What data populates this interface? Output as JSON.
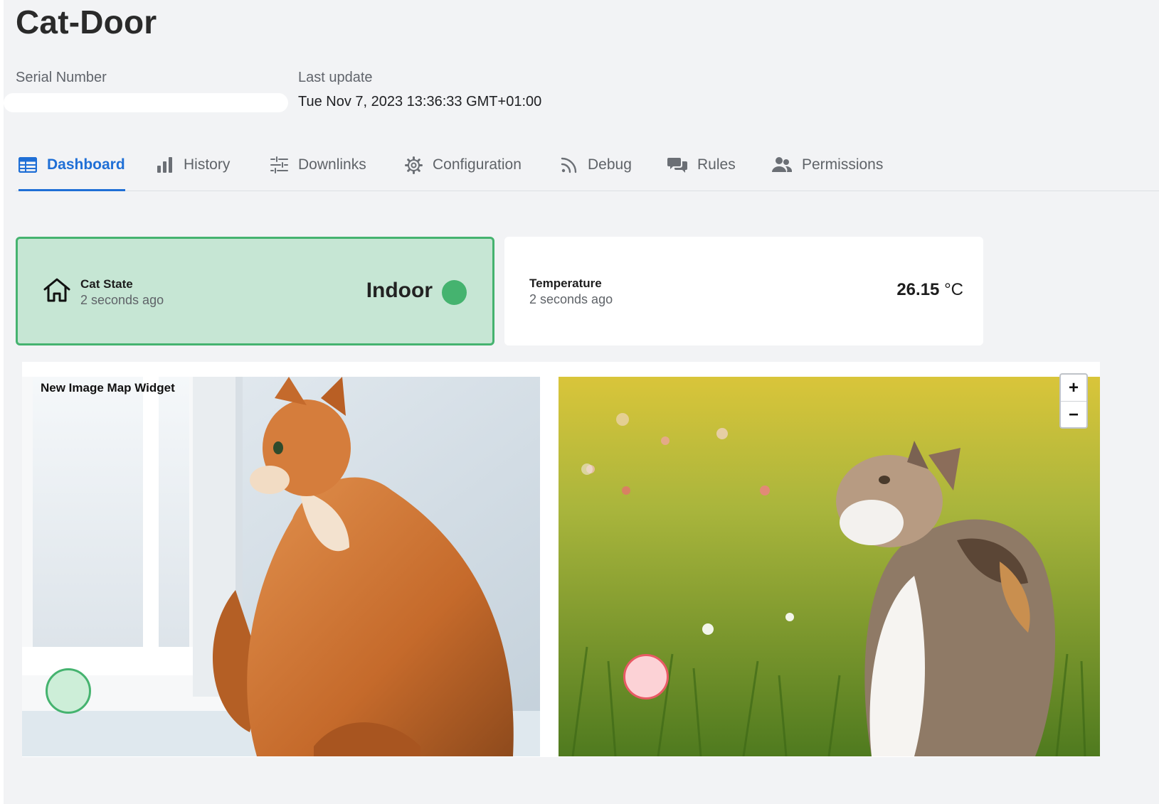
{
  "page": {
    "title": "Cat-Door"
  },
  "meta": {
    "serial_label": "Serial Number",
    "last_update_label": "Last update",
    "last_update_value": "Tue Nov 7, 2023 13:36:33 GMT+01:00"
  },
  "tabs": [
    {
      "label": "Dashboard",
      "icon": "table-icon",
      "active": true
    },
    {
      "label": "History",
      "icon": "bar-chart-icon"
    },
    {
      "label": "Downlinks",
      "icon": "sliders-icon"
    },
    {
      "label": "Configuration",
      "icon": "gear-icon"
    },
    {
      "label": "Debug",
      "icon": "rss-icon"
    },
    {
      "label": "Rules",
      "icon": "chat-bubbles-icon"
    },
    {
      "label": "Permissions",
      "icon": "users-icon"
    }
  ],
  "cards": {
    "cat_state": {
      "name": "Cat State",
      "time": "2 seconds ago",
      "value": "Indoor",
      "icon": "home-icon",
      "color": "#45b36f"
    },
    "temperature": {
      "name": "Temperature",
      "time": "2 seconds ago",
      "value": "26.15",
      "unit": "°C"
    }
  },
  "widget": {
    "title": "New Image Map Widget",
    "zoom_in": "+",
    "zoom_out": "−",
    "marker_indoor_color": "#45b36f",
    "marker_outdoor_color": "#e85a64"
  },
  "colors": {
    "accent": "#1f6fd6",
    "success": "#45b36f",
    "danger": "#e85a64"
  }
}
